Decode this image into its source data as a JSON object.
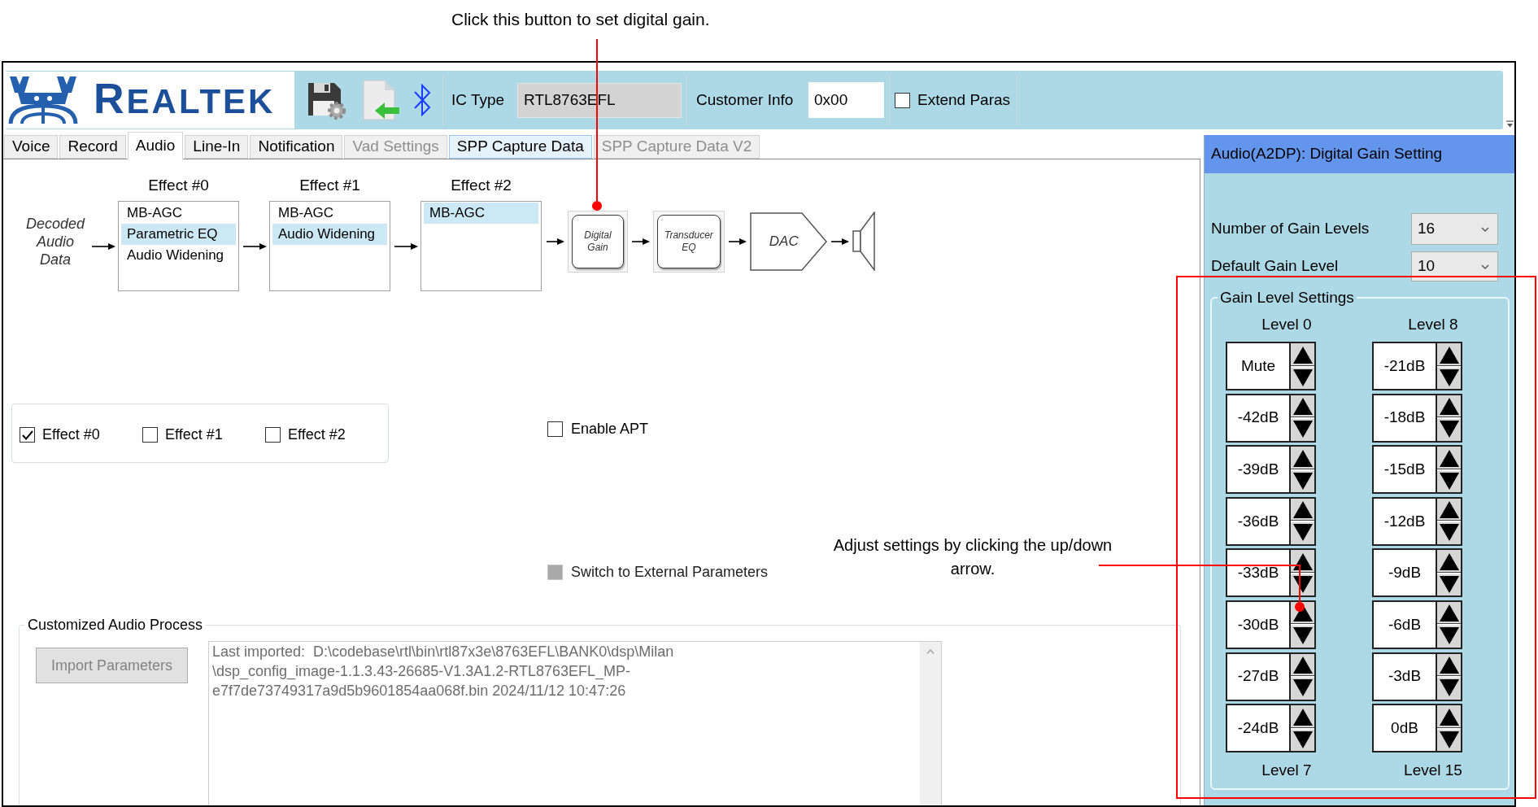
{
  "annotations": [
    {
      "text": "Click this button to set digital gain."
    },
    {
      "text": "Adjust settings by clicking the up/down arrow."
    }
  ],
  "toolbar": {
    "logo_text": "REALTEK",
    "ic_type": {
      "label": "IC Type",
      "value": "RTL8763EFL"
    },
    "customer_info": {
      "label": "Customer Info",
      "value": "0x00"
    },
    "extend_paras": {
      "label": "Extend Paras",
      "checked": false
    }
  },
  "tabs": [
    {
      "label": "Voice",
      "selected": false,
      "disabled": false,
      "hovered": false
    },
    {
      "label": "Record",
      "selected": false,
      "disabled": false,
      "hovered": false
    },
    {
      "label": "Audio",
      "selected": true,
      "disabled": false,
      "hovered": false
    },
    {
      "label": "Line-In",
      "selected": false,
      "disabled": false,
      "hovered": false
    },
    {
      "label": "Notification",
      "selected": false,
      "disabled": false,
      "hovered": false
    },
    {
      "label": "Vad Settings",
      "selected": false,
      "disabled": true,
      "hovered": false
    },
    {
      "label": "SPP Capture Data",
      "selected": false,
      "disabled": false,
      "hovered": true
    },
    {
      "label": "SPP Capture Data V2",
      "selected": false,
      "disabled": true,
      "hovered": false
    }
  ],
  "pipeline": {
    "source_label": "Decoded Audio Data",
    "effects": [
      {
        "title": "Effect #0",
        "items": [
          {
            "label": "MB-AGC",
            "selected": false
          },
          {
            "label": "Parametric EQ",
            "selected": true
          },
          {
            "label": "Audio Widening",
            "selected": false
          }
        ]
      },
      {
        "title": "Effect #1",
        "items": [
          {
            "label": "MB-AGC",
            "selected": false
          },
          {
            "label": "Audio Widening",
            "selected": true
          }
        ]
      },
      {
        "title": "Effect #2",
        "items": [
          {
            "label": "MB-AGC",
            "selected": true
          }
        ]
      }
    ],
    "stages": [
      {
        "kind": "button",
        "label": "Digital Gain"
      },
      {
        "kind": "button",
        "label": "Transducer EQ"
      },
      {
        "kind": "dac",
        "label": "DAC"
      },
      {
        "kind": "speaker"
      }
    ]
  },
  "effect_toggles": [
    {
      "label": "Effect #0",
      "checked": true
    },
    {
      "label": "Effect #1",
      "checked": false
    },
    {
      "label": "Effect #2",
      "checked": false
    }
  ],
  "enable_apt": {
    "label": "Enable APT",
    "checked": false
  },
  "external_params": {
    "label": "Switch to External Parameters",
    "checked": false,
    "disabled": true
  },
  "customized_audio_process": {
    "title": "Customized Audio Process",
    "import_button": {
      "label": "Import Parameters",
      "disabled": true
    },
    "log_lines": [
      "Last imported:  D:\\codebase\\rtl\\bin\\rtl87x3e\\8763EFL\\BANK0\\dsp\\Milan",
      "\\dsp_config_image-1.1.3.43-26685-V1.3A1.2-RTL8763EFL_MP-",
      "e7f7de73749317a9d5b9601854aa068f.bin 2024/11/12 10:47:26"
    ]
  },
  "gain_panel": {
    "title": "Audio(A2DP): Digital Gain Setting",
    "fields": [
      {
        "label": "Number of Gain Levels",
        "value": "16"
      },
      {
        "label": "Default Gain Level",
        "value": "10"
      }
    ],
    "group_title": "Gain Level Settings",
    "columns": [
      {
        "top_label": "Level 0",
        "bottom_label": "Level 7",
        "values": [
          "Mute",
          "-42dB",
          "-39dB",
          "-36dB",
          "-33dB",
          "-30dB",
          "-27dB",
          "-24dB"
        ]
      },
      {
        "top_label": "Level 8",
        "bottom_label": "Level 15",
        "values": [
          "-21dB",
          "-18dB",
          "-15dB",
          "-12dB",
          "-9dB",
          "-6dB",
          "-3dB",
          "0dB"
        ]
      }
    ]
  }
}
